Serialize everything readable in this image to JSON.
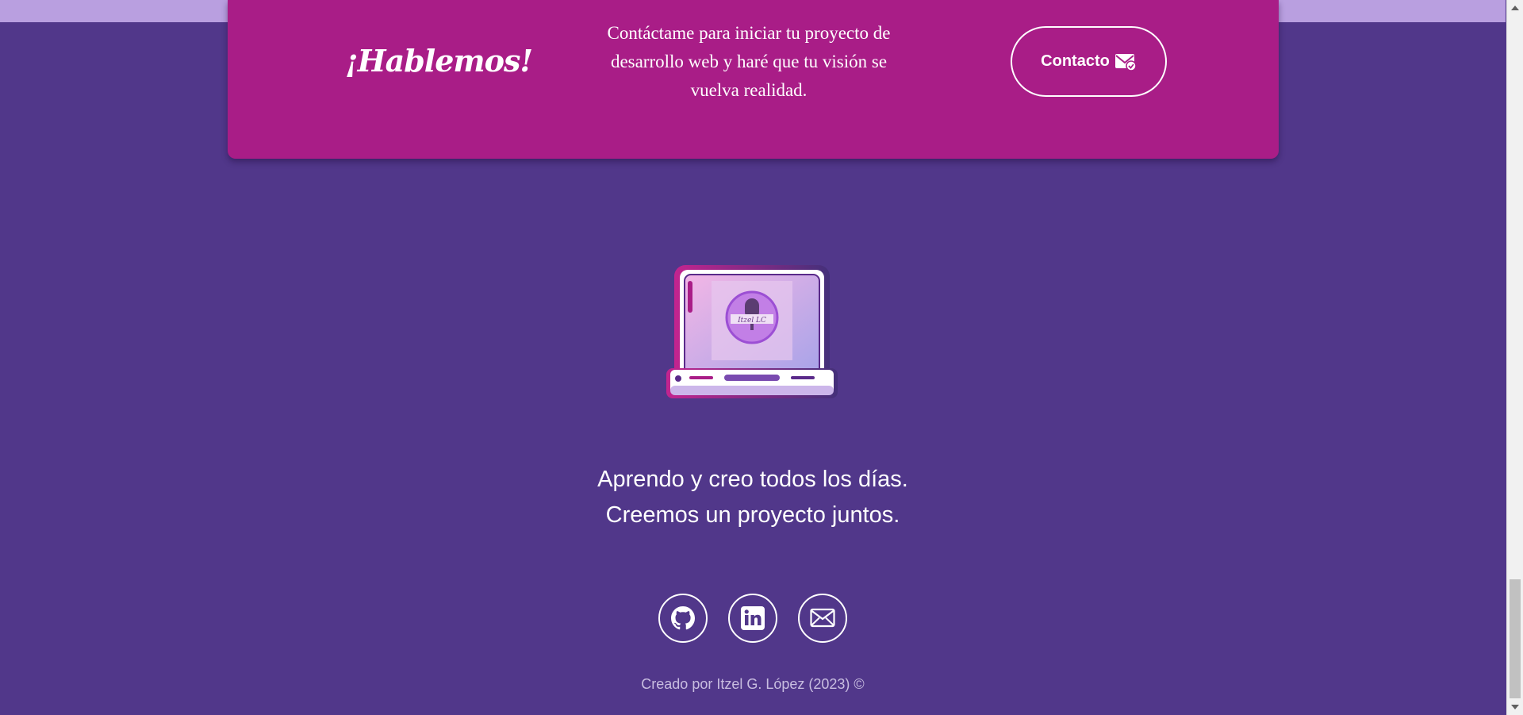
{
  "cta": {
    "title": "¡Hablemos!",
    "text": "Contáctame para iniciar tu proyecto de desarrollo web y haré que tu visión se vuelva realidad.",
    "button_label": "Contacto",
    "button_icon": "envelope-check-icon"
  },
  "illustration": {
    "icon": "laptop-illustration",
    "screen_logo_text": "Itzel LC"
  },
  "tagline": {
    "line1": "Aprendo y creo todos los días.",
    "line2": "Creemos un proyecto juntos."
  },
  "socials": [
    {
      "icon": "github-icon"
    },
    {
      "icon": "linkedin-icon"
    },
    {
      "icon": "email-icon"
    }
  ],
  "footer": {
    "credit": "Creado por Itzel G. López (2023) ©"
  },
  "colors": {
    "background": "#51378a",
    "cta_card": "#a91d87",
    "top_strip": "#b99fe0",
    "text": "#ffffff"
  }
}
